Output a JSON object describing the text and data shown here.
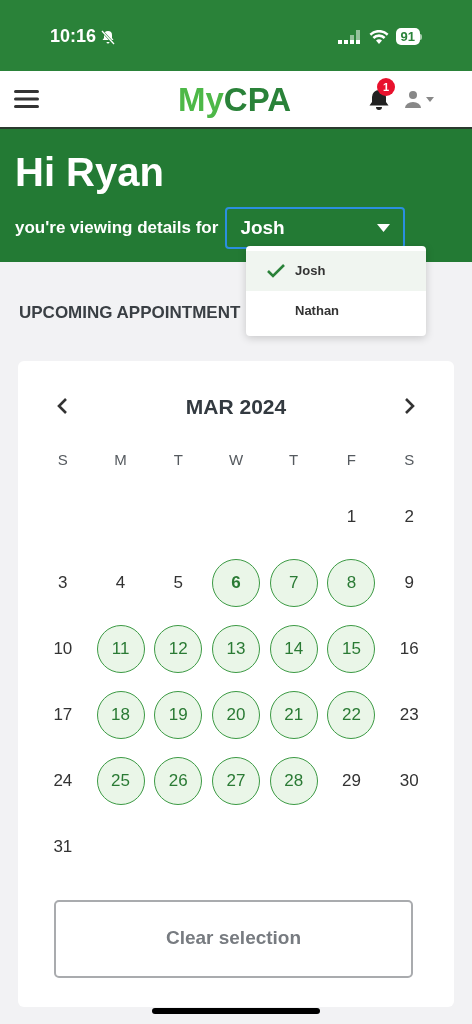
{
  "status_bar": {
    "time": "10:16",
    "battery": "91"
  },
  "nav": {
    "logo_prefix": "My",
    "logo_suffix": "CPA",
    "notification_count": "1"
  },
  "hero": {
    "greeting": "Hi Ryan",
    "prompt": "you're viewing details for",
    "selected_person": "Josh",
    "expanded": true,
    "options": [
      {
        "label": "Josh",
        "selected": true
      },
      {
        "label": "Nathan",
        "selected": false
      }
    ]
  },
  "section_title": "UPCOMING APPOINTMENT",
  "calendar": {
    "month": "MAR 2024",
    "weekdays": [
      "S",
      "M",
      "T",
      "W",
      "T",
      "F",
      "S"
    ],
    "weeks": [
      {
        "days": [
          {
            "kind": "blank"
          },
          {
            "kind": "blank"
          },
          {
            "kind": "blank"
          },
          {
            "kind": "blank"
          },
          {
            "kind": "blank"
          },
          {
            "kind": "day",
            "label": "1",
            "available": false,
            "today": false
          },
          {
            "kind": "day",
            "label": "2",
            "available": false,
            "today": false
          }
        ]
      },
      {
        "days": [
          {
            "kind": "day",
            "label": "3",
            "available": false,
            "today": false
          },
          {
            "kind": "day",
            "label": "4",
            "available": false,
            "today": false
          },
          {
            "kind": "day",
            "label": "5",
            "available": false,
            "today": false
          },
          {
            "kind": "day",
            "label": "6",
            "available": true,
            "today": true
          },
          {
            "kind": "day",
            "label": "7",
            "available": true,
            "today": false
          },
          {
            "kind": "day",
            "label": "8",
            "available": true,
            "today": false
          },
          {
            "kind": "day",
            "label": "9",
            "available": false,
            "today": false
          }
        ]
      },
      {
        "days": [
          {
            "kind": "day",
            "label": "10",
            "available": false,
            "today": false
          },
          {
            "kind": "day",
            "label": "11",
            "available": true,
            "today": false
          },
          {
            "kind": "day",
            "label": "12",
            "available": true,
            "today": false
          },
          {
            "kind": "day",
            "label": "13",
            "available": true,
            "today": false
          },
          {
            "kind": "day",
            "label": "14",
            "available": true,
            "today": false
          },
          {
            "kind": "day",
            "label": "15",
            "available": true,
            "today": false
          },
          {
            "kind": "day",
            "label": "16",
            "available": false,
            "today": false
          }
        ]
      },
      {
        "days": [
          {
            "kind": "day",
            "label": "17",
            "available": false,
            "today": false
          },
          {
            "kind": "day",
            "label": "18",
            "available": true,
            "today": false
          },
          {
            "kind": "day",
            "label": "19",
            "available": true,
            "today": false
          },
          {
            "kind": "day",
            "label": "20",
            "available": true,
            "today": false
          },
          {
            "kind": "day",
            "label": "21",
            "available": true,
            "today": false
          },
          {
            "kind": "day",
            "label": "22",
            "available": true,
            "today": false
          },
          {
            "kind": "day",
            "label": "23",
            "available": false,
            "today": false
          }
        ]
      },
      {
        "days": [
          {
            "kind": "day",
            "label": "24",
            "available": false,
            "today": false
          },
          {
            "kind": "day",
            "label": "25",
            "available": true,
            "today": false
          },
          {
            "kind": "day",
            "label": "26",
            "available": true,
            "today": false
          },
          {
            "kind": "day",
            "label": "27",
            "available": true,
            "today": false
          },
          {
            "kind": "day",
            "label": "28",
            "available": true,
            "today": false
          },
          {
            "kind": "day",
            "label": "29",
            "available": false,
            "today": false
          },
          {
            "kind": "day",
            "label": "30",
            "available": false,
            "today": false
          }
        ]
      },
      {
        "days": [
          {
            "kind": "day",
            "label": "31",
            "available": false,
            "today": false
          }
        ]
      }
    ],
    "clear_button": "Clear selection"
  }
}
